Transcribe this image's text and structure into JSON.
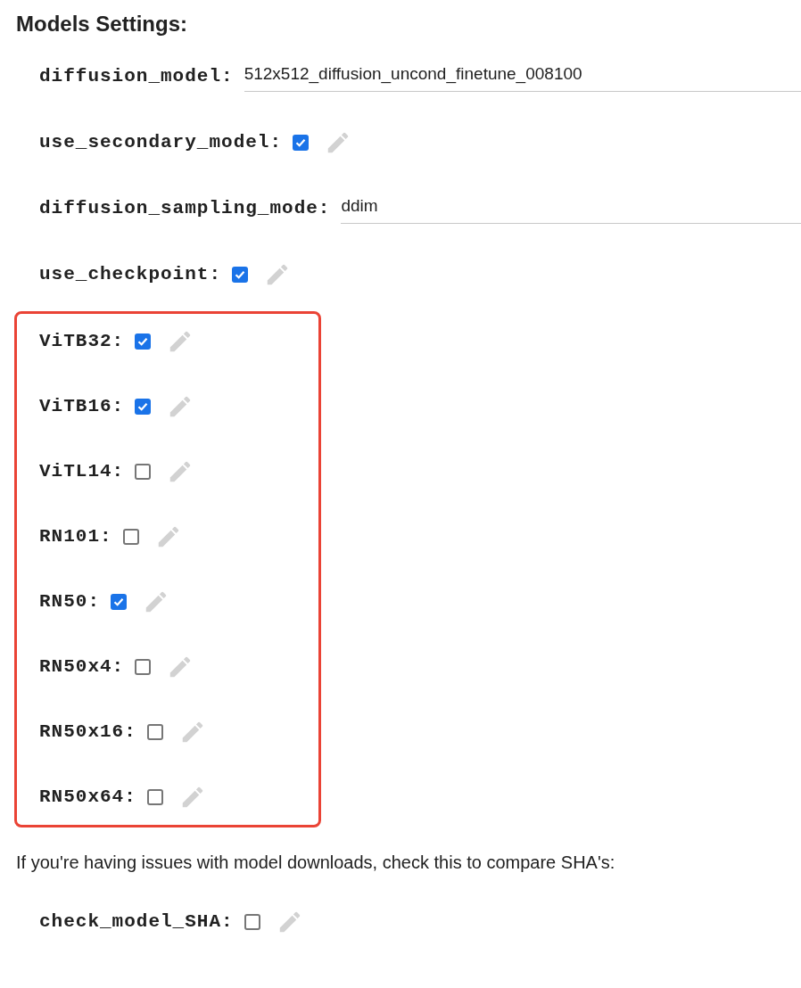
{
  "title": "Models Settings:",
  "rows": [
    {
      "kind": "text",
      "label": "diffusion_model:",
      "value": "512x512_diffusion_uncond_finetune_008100"
    },
    {
      "kind": "checkbox",
      "label": "use_secondary_model:",
      "checked": true
    },
    {
      "kind": "text",
      "label": "diffusion_sampling_mode:",
      "value": "ddim"
    },
    {
      "kind": "checkbox",
      "label": "use_checkpoint:",
      "checked": true
    }
  ],
  "highlighted_rows": [
    {
      "kind": "checkbox",
      "label": "ViTB32:",
      "checked": true
    },
    {
      "kind": "checkbox",
      "label": "ViTB16:",
      "checked": true
    },
    {
      "kind": "checkbox",
      "label": "ViTL14:",
      "checked": false
    },
    {
      "kind": "checkbox",
      "label": "RN101:",
      "checked": false
    },
    {
      "kind": "checkbox",
      "label": "RN50:",
      "checked": true
    },
    {
      "kind": "checkbox",
      "label": "RN50x4:",
      "checked": false
    },
    {
      "kind": "checkbox",
      "label": "RN50x16:",
      "checked": false
    },
    {
      "kind": "checkbox",
      "label": "RN50x64:",
      "checked": false
    }
  ],
  "note": "If you're having issues with model downloads, check this to compare SHA's:",
  "footer_rows": [
    {
      "kind": "checkbox",
      "label": "check_model_SHA:",
      "checked": false
    }
  ]
}
